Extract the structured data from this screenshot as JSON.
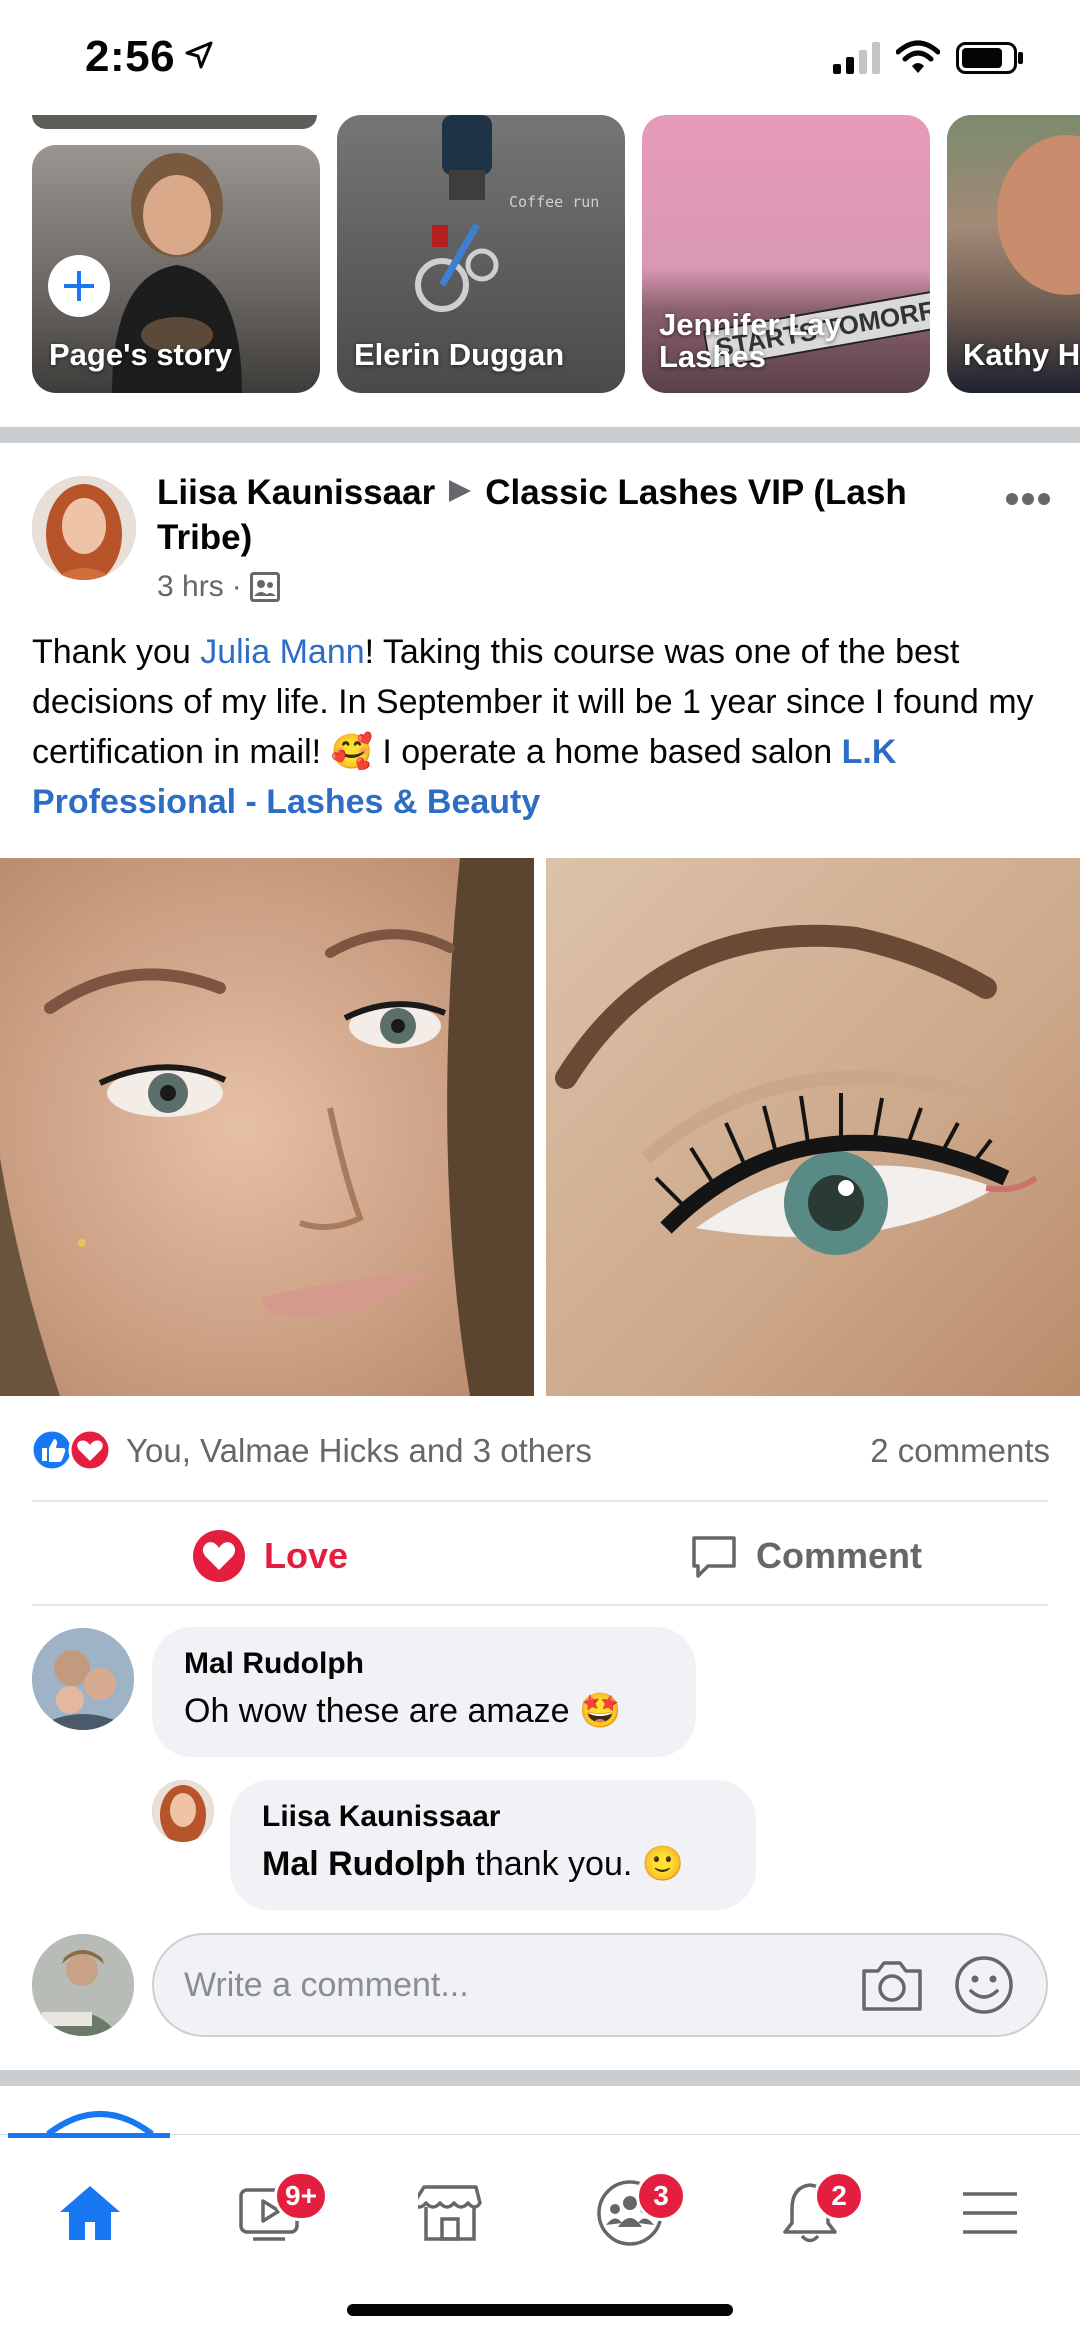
{
  "status_bar": {
    "time": "2:56"
  },
  "stories": [
    {
      "label": "Page's story"
    },
    {
      "label": "Elerin Duggan",
      "overlay_text": "Coffee run"
    },
    {
      "label": "Jennifer Lay Lashes",
      "label_line1": "Jennifer Lay",
      "label_line2": "Lashes",
      "sticker_text": "STARTS TOMORROW!"
    },
    {
      "label": "Kathy H"
    }
  ],
  "post": {
    "author": "Liisa Kaunissaar",
    "group": "Classic Lashes VIP (Lash Tribe)",
    "time": "3 hrs",
    "text_1": "Thank you ",
    "mention": "Julia Mann",
    "text_2": "! Taking this course was one of the best decisions of my life. In September it will be 1 year since I found my certification in mail! ",
    "emoji": "🥰",
    "text_3": " I operate a home based salon ",
    "page_link": "L.K Professional - Lashes & Beauty",
    "reactions_summary": "You, Valmae Hicks and 3 others",
    "comments_count": "2 comments",
    "love_label": "Love",
    "comment_label": "Comment"
  },
  "comments": [
    {
      "name": "Mal Rudolph",
      "message": "Oh wow these are amaze 🤩"
    },
    {
      "name": "Liisa Kaunissaar",
      "mention": "Mal Rudolph",
      "message": " thank you. 🙂"
    }
  ],
  "comment_input": {
    "placeholder": "Write a comment..."
  },
  "nav": {
    "watch_badge": "9+",
    "groups_badge": "3",
    "notifications_badge": "2"
  },
  "colors": {
    "accent": "#1877f2",
    "love": "#e41e3f",
    "link": "#2d6ec4",
    "secondary_text": "#65676b"
  }
}
